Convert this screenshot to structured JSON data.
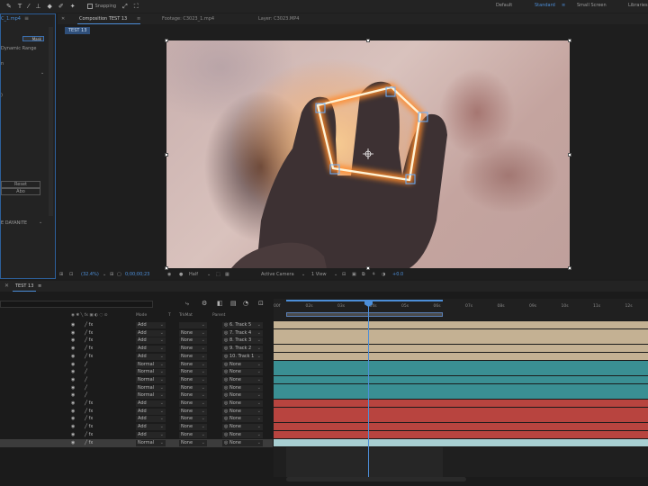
{
  "toolbar": {
    "snapping_label": "Snapping",
    "workspaces": [
      "Default",
      "Standard",
      "Small Screen",
      "Libraries"
    ],
    "active_workspace": "Standard"
  },
  "left_panel": {
    "tab_label": "C_1.mp4",
    "rows": [
      "Mask",
      "Dynamic Range"
    ],
    "dropdown_value": "Mask",
    "reset_label": "Reset",
    "about_label": "Abo",
    "bottom_label": "E DAYANITE"
  },
  "comp_panel": {
    "tabs": [
      {
        "label": "Composition TEST 13",
        "active": true
      },
      {
        "label": "Footage: C3023_1.mp4",
        "active": false
      },
      {
        "label": "Layer: C3023.MP4",
        "active": false
      }
    ],
    "comp_chip": "TEST 13",
    "viewer_bar": {
      "zoom": "(32.4%)",
      "timecode": "0;00;00;23",
      "resolution": "Half",
      "camera": "Active Camera",
      "views": "1 View",
      "exposure": "+0.0"
    }
  },
  "timeline": {
    "tab_label": "TEST 13",
    "col_mode": "Mode",
    "col_trkmat": "TrkMat",
    "col_parent": "Parent",
    "ruler_ticks": [
      "00f",
      "02s",
      "03s",
      "04s",
      "05s",
      "06s",
      "07s",
      "08s",
      "09s",
      "10s",
      "11s",
      "12s"
    ],
    "layers": [
      {
        "mode": "Add",
        "trkmat": "",
        "parent": "6. Track 5",
        "fx": true,
        "color": "#c4b193"
      },
      {
        "mode": "Add",
        "trkmat": "None",
        "parent": "7. Track 4",
        "fx": true,
        "color": "#c4b193"
      },
      {
        "mode": "Add",
        "trkmat": "None",
        "parent": "8. Track 3",
        "fx": true,
        "color": "#c4b193"
      },
      {
        "mode": "Add",
        "trkmat": "None",
        "parent": "9. Track 2",
        "fx": true,
        "color": "#c4b193"
      },
      {
        "mode": "Add",
        "trkmat": "None",
        "parent": "10. Track 1",
        "fx": true,
        "color": "#c4b193"
      },
      {
        "mode": "Normal",
        "trkmat": "None",
        "parent": "None",
        "fx": false,
        "color": "#3a8f93"
      },
      {
        "mode": "Normal",
        "trkmat": "None",
        "parent": "None",
        "fx": false,
        "color": "#3a8f93"
      },
      {
        "mode": "Normal",
        "trkmat": "None",
        "parent": "None",
        "fx": false,
        "color": "#3a8f93"
      },
      {
        "mode": "Normal",
        "trkmat": "None",
        "parent": "None",
        "fx": false,
        "color": "#3a8f93"
      },
      {
        "mode": "Normal",
        "trkmat": "None",
        "parent": "None",
        "fx": false,
        "color": "#3a8f93"
      },
      {
        "mode": "Add",
        "trkmat": "None",
        "parent": "None",
        "fx": true,
        "color": "#b8443f"
      },
      {
        "mode": "Add",
        "trkmat": "None",
        "parent": "None",
        "fx": true,
        "color": "#b8443f"
      },
      {
        "mode": "Add",
        "trkmat": "None",
        "parent": "None",
        "fx": true,
        "color": "#b8443f"
      },
      {
        "mode": "Add",
        "trkmat": "None",
        "parent": "None",
        "fx": true,
        "color": "#b8443f"
      },
      {
        "mode": "Add",
        "trkmat": "None",
        "parent": "None",
        "fx": true,
        "color": "#b8443f"
      },
      {
        "mode": "Normal",
        "trkmat": "None",
        "parent": "None",
        "fx": true,
        "color": "#a8cfd2",
        "selected": true
      }
    ]
  },
  "colors": {
    "accent": "#4c8ed8",
    "glow": "#ff8a2a"
  }
}
